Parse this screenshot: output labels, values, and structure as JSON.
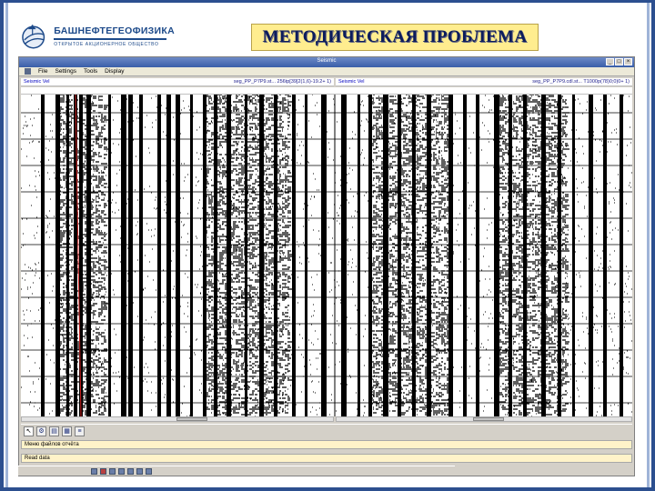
{
  "logo": {
    "name": "БАШНЕФТЕГЕОФИЗИКА",
    "subtitle": "ОТКРЫТОЕ АКЦИОНЕРНОЕ ОБЩЕСТВО"
  },
  "slide_title": "МЕТОДИЧЕСКАЯ ПРОБЛЕМА",
  "window": {
    "title": "Seismic",
    "menu": [
      "File",
      "Settings",
      "Tools",
      "Display"
    ]
  },
  "panes": [
    {
      "left_label": "Seismic Vel",
      "right_label": "seg_PP_P7P9.st... 256tp[39]2(1,6)-19.2+ 1)"
    },
    {
      "left_label": "Seismic Vel",
      "right_label": "seg_PP_P7P9.cdl.st... T1000p(78)0;0)0+ 1)"
    }
  ],
  "status": {
    "line1": "Меню файлов отчёта",
    "line2": "Read data"
  },
  "colors": {
    "accent": "#2c4f8f",
    "banner": "#ffed8f",
    "title_text": "#0b1c5c",
    "status_bg": "#fff3c9"
  },
  "icons": [
    "pointer-icon",
    "gear-icon",
    "chart-icon",
    "grid-icon",
    "list-icon"
  ]
}
